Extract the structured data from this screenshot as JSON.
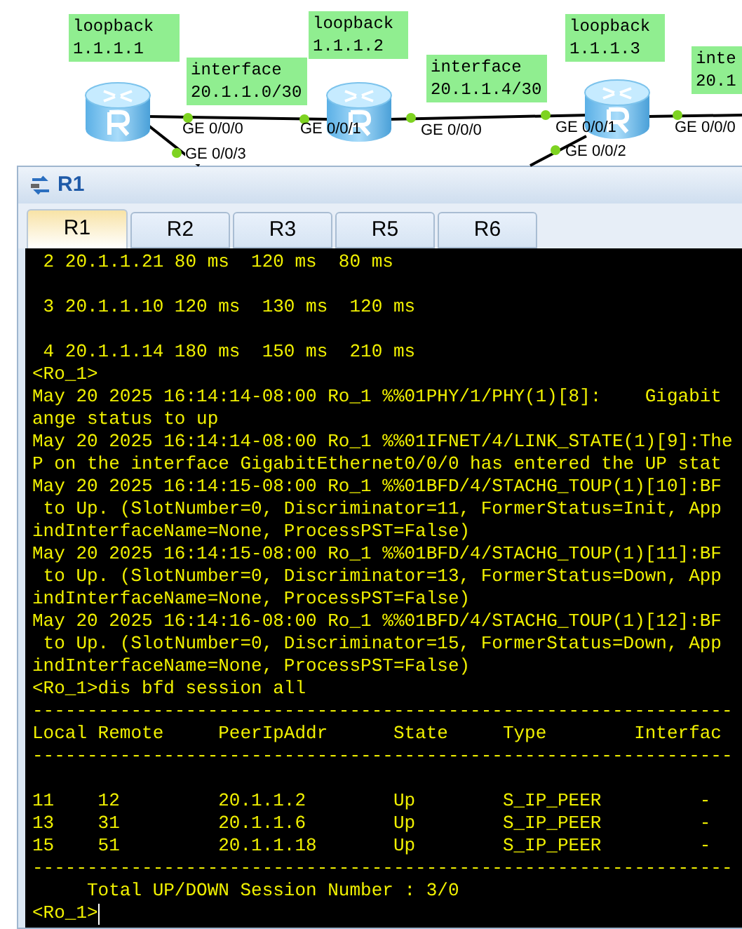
{
  "topology": {
    "labels": [
      {
        "lines": [
          "loopback",
          "1.1.1.1"
        ]
      },
      {
        "lines": [
          "interface",
          "20.1.1.0/30"
        ]
      },
      {
        "lines": [
          "loopback",
          "1.1.1.2"
        ]
      },
      {
        "lines": [
          "interface",
          "20.1.1.4/30"
        ]
      },
      {
        "lines": [
          "loopback",
          "1.1.1.3"
        ]
      },
      {
        "lines": [
          "inte",
          "20.1"
        ]
      }
    ],
    "ports": [
      "GE 0/0/0",
      "GE 0/0/1",
      "GE 0/0/0",
      "GE 0/0/1",
      "GE 0/0/0",
      "GE 0/0/3",
      "GE 0/0/2"
    ]
  },
  "window": {
    "title": "R1",
    "tabs": [
      {
        "label": "R1",
        "selected": true
      },
      {
        "label": "R2",
        "selected": false
      },
      {
        "label": "R3",
        "selected": false
      },
      {
        "label": "R5",
        "selected": false
      },
      {
        "label": "R6",
        "selected": false
      }
    ],
    "terminal": {
      "lines": [
        {
          "kind": "text",
          "text": " 2 20.1.1.21 80 ms  120 ms  80 ms"
        },
        {
          "kind": "blank"
        },
        {
          "kind": "text",
          "text": " 3 20.1.1.10 120 ms  130 ms  120 ms"
        },
        {
          "kind": "blank"
        },
        {
          "kind": "text",
          "text": " 4 20.1.1.14 180 ms  150 ms  210 ms"
        },
        {
          "kind": "text",
          "text": "<Ro_1>"
        },
        {
          "kind": "text",
          "text": "May 20 2025 16:14:14-08:00 Ro_1 %%01PHY/1/PHY(1)[8]:    Gigabit"
        },
        {
          "kind": "text",
          "text": "ange status to up"
        },
        {
          "kind": "text",
          "text": "May 20 2025 16:14:14-08:00 Ro_1 %%01IFNET/4/LINK_STATE(1)[9]:The"
        },
        {
          "kind": "text",
          "text": "P on the interface GigabitEthernet0/0/0 has entered the UP stat"
        },
        {
          "kind": "text",
          "text": "May 20 2025 16:14:15-08:00 Ro_1 %%01BFD/4/STACHG_TOUP(1)[10]:BF"
        },
        {
          "kind": "text",
          "text": " to Up. (SlotNumber=0, Discriminator=11, FormerStatus=Init, App"
        },
        {
          "kind": "text",
          "text": "indInterfaceName=None, ProcessPST=False)"
        },
        {
          "kind": "text",
          "text": "May 20 2025 16:14:15-08:00 Ro_1 %%01BFD/4/STACHG_TOUP(1)[11]:BF"
        },
        {
          "kind": "text",
          "text": " to Up. (SlotNumber=0, Discriminator=13, FormerStatus=Down, App"
        },
        {
          "kind": "text",
          "text": "indInterfaceName=None, ProcessPST=False)"
        },
        {
          "kind": "text",
          "text": "May 20 2025 16:14:16-08:00 Ro_1 %%01BFD/4/STACHG_TOUP(1)[12]:BF"
        },
        {
          "kind": "text",
          "text": " to Up. (SlotNumber=0, Discriminator=15, FormerStatus=Down, App"
        },
        {
          "kind": "text",
          "text": "indInterfaceName=None, ProcessPST=False)"
        },
        {
          "kind": "text",
          "text": "<Ro_1>dis bfd session all"
        },
        {
          "kind": "text",
          "text": "----------------------------------------------------------------"
        },
        {
          "kind": "text",
          "text": "Local Remote     PeerIpAddr      State     Type        Interfac"
        },
        {
          "kind": "text",
          "text": "----------------------------------------------------------------"
        },
        {
          "kind": "blank"
        },
        {
          "kind": "text",
          "text": "11    12         20.1.1.2        Up        S_IP_PEER         -"
        },
        {
          "kind": "text",
          "text": "13    31         20.1.1.6        Up        S_IP_PEER         -"
        },
        {
          "kind": "text",
          "text": "15    51         20.1.1.18       Up        S_IP_PEER         -"
        },
        {
          "kind": "text",
          "text": "----------------------------------------------------------------"
        },
        {
          "kind": "text",
          "text": "     Total UP/DOWN Session Number : 3/0"
        },
        {
          "kind": "text",
          "text": "<Ro_1>"
        }
      ],
      "cursor": true
    }
  }
}
